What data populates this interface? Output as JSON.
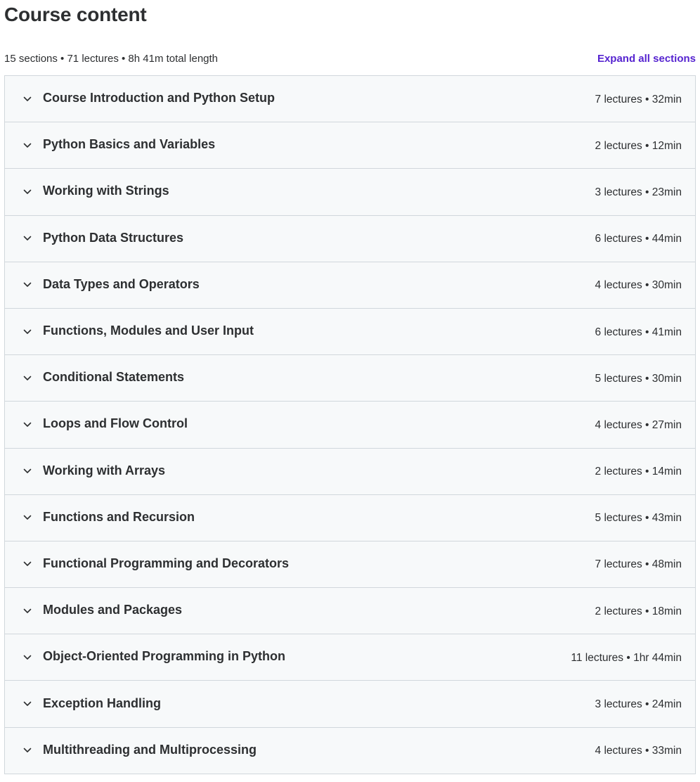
{
  "page": {
    "title": "Course content",
    "summary": "15 sections • 71 lectures • 8h 41m total length",
    "expand_label": "Expand all sections",
    "accent_color": "#5624d0"
  },
  "sections": [
    {
      "title": "Course Introduction and Python Setup",
      "meta": "7 lectures • 32min"
    },
    {
      "title": "Python Basics and Variables",
      "meta": "2 lectures • 12min"
    },
    {
      "title": "Working with Strings",
      "meta": "3 lectures • 23min"
    },
    {
      "title": "Python Data Structures",
      "meta": "6 lectures • 44min"
    },
    {
      "title": "Data Types and Operators",
      "meta": "4 lectures • 30min"
    },
    {
      "title": "Functions, Modules and User Input",
      "meta": "6 lectures • 41min"
    },
    {
      "title": "Conditional Statements",
      "meta": "5 lectures • 30min"
    },
    {
      "title": "Loops and Flow Control",
      "meta": "4 lectures • 27min"
    },
    {
      "title": "Working with Arrays",
      "meta": "2 lectures • 14min"
    },
    {
      "title": "Functions and Recursion",
      "meta": "5 lectures • 43min"
    },
    {
      "title": "Functional Programming and Decorators",
      "meta": "7 lectures • 48min"
    },
    {
      "title": "Modules and Packages",
      "meta": "2 lectures • 18min"
    },
    {
      "title": "Object-Oriented Programming in Python",
      "meta": "11 lectures • 1hr 44min"
    },
    {
      "title": "Exception Handling",
      "meta": "3 lectures • 24min"
    },
    {
      "title": "Multithreading and Multiprocessing",
      "meta": "4 lectures • 33min"
    }
  ]
}
